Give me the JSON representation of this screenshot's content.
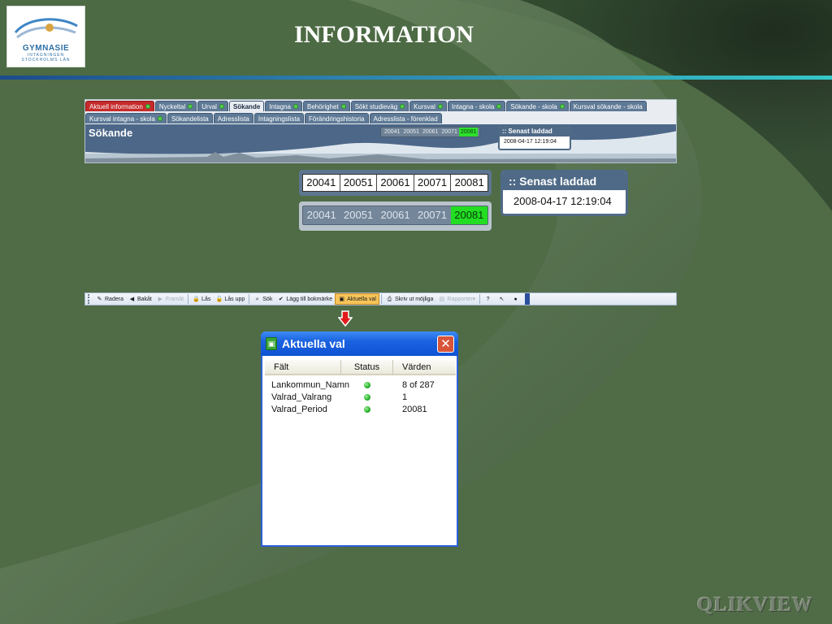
{
  "logo": {
    "name": "GYMNASIE",
    "sub1": "INTAGNINGEN",
    "sub2": "STOCKHOLMS LÄN"
  },
  "page_title": "INFORMATION",
  "brand": "QLIKVIEW",
  "colors": {
    "accent_line": "#35c7c9",
    "selected_period": "#22dd22",
    "tab_active_red": "#c62b2b",
    "status_green": "#26b12a"
  },
  "tabs_row1": [
    {
      "label": "Aktuell information",
      "dot": true,
      "red": true
    },
    {
      "label": "Nyckeltal",
      "dot": true
    },
    {
      "label": "Urval",
      "dot": true
    },
    {
      "label": "Sökande",
      "active": true
    },
    {
      "label": "Intagna",
      "dot": true
    },
    {
      "label": "Behörighet",
      "dot": true
    },
    {
      "label": "Sökt studieväg",
      "dot": true
    },
    {
      "label": "Kursval",
      "dot": true
    },
    {
      "label": "Intagna - skola",
      "dot": true
    },
    {
      "label": "Sökande - skola",
      "dot": true
    },
    {
      "label": "Kursval sökande - skola"
    }
  ],
  "tabs_row2": [
    {
      "label": "Kursval intagna - skola",
      "dot": true
    },
    {
      "label": "Sökandelista"
    },
    {
      "label": "Adresslista"
    },
    {
      "label": "Intagningslista"
    },
    {
      "label": "Förändringshistoria"
    },
    {
      "label": "Adresslista - förenklad"
    }
  ],
  "banner": {
    "title": "Sökande"
  },
  "periods": [
    "20041",
    "20051",
    "20061",
    "20071",
    "20081"
  ],
  "selected_period": "20081",
  "last_loaded": {
    "label": ":: Senast laddad",
    "value": "2008-04-17 12:19:04"
  },
  "toolbar": [
    {
      "label": "Radera",
      "icon": "eraser-icon",
      "glyph": "✎"
    },
    {
      "label": "Bakåt",
      "icon": "back-icon",
      "glyph": "◀"
    },
    {
      "label": "Framåt",
      "icon": "forward-icon",
      "glyph": "▶",
      "disabled": true
    },
    {
      "sep": true
    },
    {
      "label": "Lås",
      "icon": "lock-icon",
      "glyph": "🔒"
    },
    {
      "label": "Lås upp",
      "icon": "unlock-icon",
      "glyph": "🔓"
    },
    {
      "sep": true
    },
    {
      "label": "Sök",
      "icon": "search-icon",
      "glyph": "⌕"
    },
    {
      "label": "Lägg till bokmärke",
      "icon": "bookmark-icon",
      "glyph": "✔"
    },
    {
      "label": "Aktuella val",
      "icon": "current-selections-icon",
      "glyph": "▣",
      "active": true
    },
    {
      "sep": true
    },
    {
      "label": "Skriv ut möjliga",
      "icon": "print-icon",
      "glyph": "⎙"
    },
    {
      "label": "Rapporter",
      "icon": "reports-icon",
      "glyph": "▤",
      "disabled": true,
      "dropdown": true
    },
    {
      "sep": true
    },
    {
      "label": "",
      "icon": "help-icon",
      "glyph": "?"
    },
    {
      "label": "",
      "icon": "context-help-icon",
      "glyph": "↖"
    },
    {
      "label": "",
      "icon": "chat-icon",
      "glyph": "●"
    }
  ],
  "dialog": {
    "title": "Aktuella val",
    "close_glyph": "✕",
    "columns": [
      "Fält",
      "Status",
      "Värden"
    ],
    "rows": [
      {
        "field": "Lankommun_Namn",
        "value": "8 of 287"
      },
      {
        "field": "Valrad_Valrang",
        "value": "1"
      },
      {
        "field": "Valrad_Period",
        "value": "20081"
      }
    ]
  }
}
